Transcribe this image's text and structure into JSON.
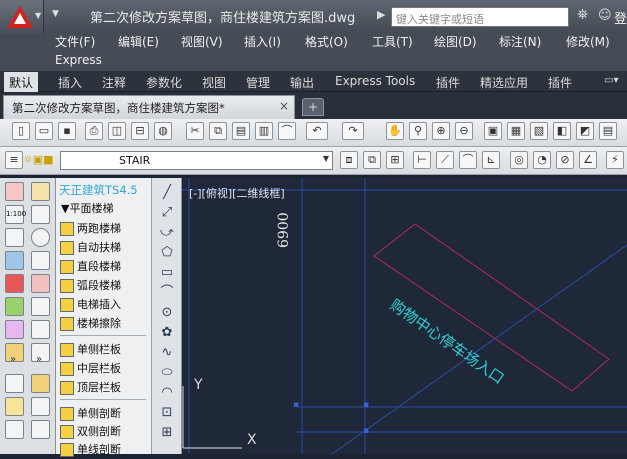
{
  "titlebar": {
    "title": "第二次修改方案草图，商住楼建筑方案图.dwg",
    "search_placeholder": "键入关键字或短语",
    "signin": "登"
  },
  "menu": {
    "row1": [
      "文件(F)",
      "编辑(E)",
      "视图(V)",
      "插入(I)",
      "格式(O)",
      "工具(T)",
      "绘图(D)",
      "标注(N)",
      "修改(M)"
    ],
    "row2": [
      "Express"
    ]
  },
  "ribbon_tabs": [
    "默认",
    "插入",
    "注释",
    "参数化",
    "视图",
    "管理",
    "输出",
    "Express Tools",
    "插件",
    "精选应用",
    "插件"
  ],
  "doc_tab": {
    "label": "第二次修改方案草图，商住楼建筑方案图*",
    "close": "×"
  },
  "layer": {
    "current": "STAIR"
  },
  "tangent_panel": {
    "header": "天正建筑TS4.5",
    "section": "▼平面楼梯",
    "items": [
      "两跑楼梯",
      "自动扶梯",
      "直段楼梯",
      "弧段楼梯",
      "电梯插入",
      "楼梯擦除",
      "单侧栏板",
      "中层栏板",
      "顶层栏板",
      "单侧剖断",
      "双侧剖断",
      "单线剖断"
    ]
  },
  "canvas": {
    "view_label": "[-][俯视][二维线框]",
    "dimension": "6900",
    "annotation": "购物中心停车场入口",
    "ucs_y": "Y",
    "ucs_x": "X"
  },
  "colors": {
    "canvas_bg": "#1f2838",
    "grid_line": "#2a4aa8",
    "annotation_text": "#2fd0d4",
    "box_outline": "#b02a5a"
  }
}
